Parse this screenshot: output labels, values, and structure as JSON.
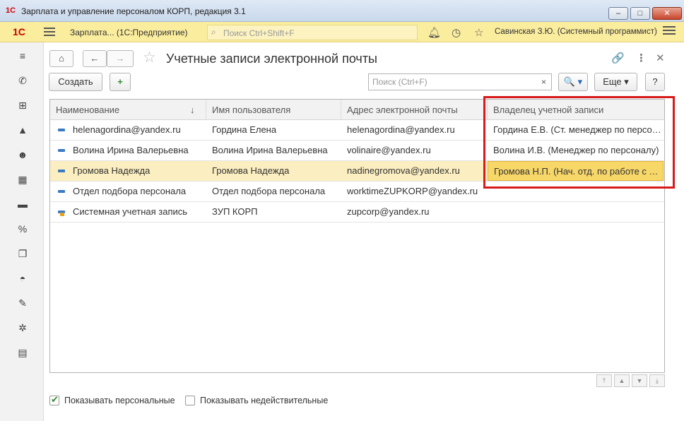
{
  "window": {
    "title": "Зарплата и управление персоналом КОРП, редакция 3.1",
    "app_icon": "1C",
    "min_symbol": "‒",
    "max_symbol": "□",
    "close_symbol": "✕"
  },
  "topbar": {
    "logo": "1С",
    "app_name": "Зарплата...  (1С:Предприятие)",
    "search_placeholder": "Поиск Ctrl+Shift+F",
    "user": "Савинская З.Ю. (Системный программист)",
    "icons": [
      "bell-icon",
      "history-icon",
      "star-icon",
      "menu-icon"
    ]
  },
  "sidebar": {
    "items": [
      {
        "icon": "menu-icon",
        "glyph": "≡"
      },
      {
        "icon": "phone-icon",
        "glyph": "✆"
      },
      {
        "icon": "gift-icon",
        "glyph": "⊞"
      },
      {
        "icon": "graduation-cap-icon",
        "glyph": "▲"
      },
      {
        "icon": "users-icon",
        "glyph": "☻"
      },
      {
        "icon": "calculator-icon",
        "glyph": "▦"
      },
      {
        "icon": "card-icon",
        "glyph": "▬"
      },
      {
        "icon": "percent-icon",
        "glyph": "%"
      },
      {
        "icon": "documents-icon",
        "glyph": "❐"
      },
      {
        "icon": "helmet-icon",
        "glyph": "◓"
      },
      {
        "icon": "wrench-icon",
        "glyph": "✎"
      },
      {
        "icon": "gear-icon",
        "glyph": "✲"
      },
      {
        "icon": "id-card-icon",
        "glyph": "▤"
      }
    ]
  },
  "header": {
    "home_glyph": "⌂",
    "back_glyph": "←",
    "forward_glyph": "→",
    "star_glyph": "☆",
    "title": "Учетные записи электронной почты",
    "link_glyph": "🔗",
    "more_glyph": "⋮",
    "close_glyph": "✕"
  },
  "toolbar": {
    "create_label": "Создать",
    "create_doc_glyph": "+",
    "search_placeholder": "Поиск (Ctrl+F)",
    "clear_glyph": "×",
    "search_btn_label": "🔍 ▾",
    "more_label": "Еще ▾",
    "help_label": "?"
  },
  "table": {
    "columns": [
      {
        "label": "Наименование",
        "sort": "↓"
      },
      {
        "label": "Имя пользователя"
      },
      {
        "label": "Адрес электронной почты"
      },
      {
        "label": "Владелец учетной записи"
      }
    ],
    "rows": [
      {
        "name": "helenagordina@yandex.ru",
        "user": "Гордина Елена",
        "email": "helenagordina@yandex.ru",
        "owner": "Гордина Е.В. (Ст. менеджер по персо…",
        "selected": false,
        "icon": "account-icon"
      },
      {
        "name": "Волина Ирина Валерьевна",
        "user": "Волина Ирина Валерьевна",
        "email": "volinaire@yandex.ru",
        "owner": "Волина И.В. (Менеджер по персоналу)",
        "selected": false,
        "icon": "account-icon"
      },
      {
        "name": "Громова Надежда",
        "user": "Громова Надежда",
        "email": "nadinegromova@yandex.ru",
        "owner": "Громова Н.П. (Нач. отд. по работе с …",
        "selected": true,
        "icon": "account-icon"
      },
      {
        "name": "Отдел подбора персонала",
        "user": "Отдел подбора персонала",
        "email": "worktimeZUPKORP@yandex.ru",
        "owner": "",
        "selected": false,
        "icon": "account-icon"
      },
      {
        "name": "Системная учетная запись",
        "user": "ЗУП КОРП",
        "email": "zupcorp@yandex.ru",
        "owner": "",
        "selected": false,
        "icon": "system-account-icon"
      }
    ]
  },
  "scroll": {
    "top": "⤒",
    "up": "▲",
    "down": "▼",
    "bottom": "⤓"
  },
  "footer": {
    "show_personal": {
      "label": "Показывать персональные",
      "checked": true
    },
    "show_invalid": {
      "label": "Показывать недействительные",
      "checked": false
    }
  },
  "colors": {
    "header_bar": "#fbed9e",
    "selected_row": "#fbeec0",
    "focused_cell": "#f8d769",
    "annotation_frame": "#d91a1a"
  }
}
